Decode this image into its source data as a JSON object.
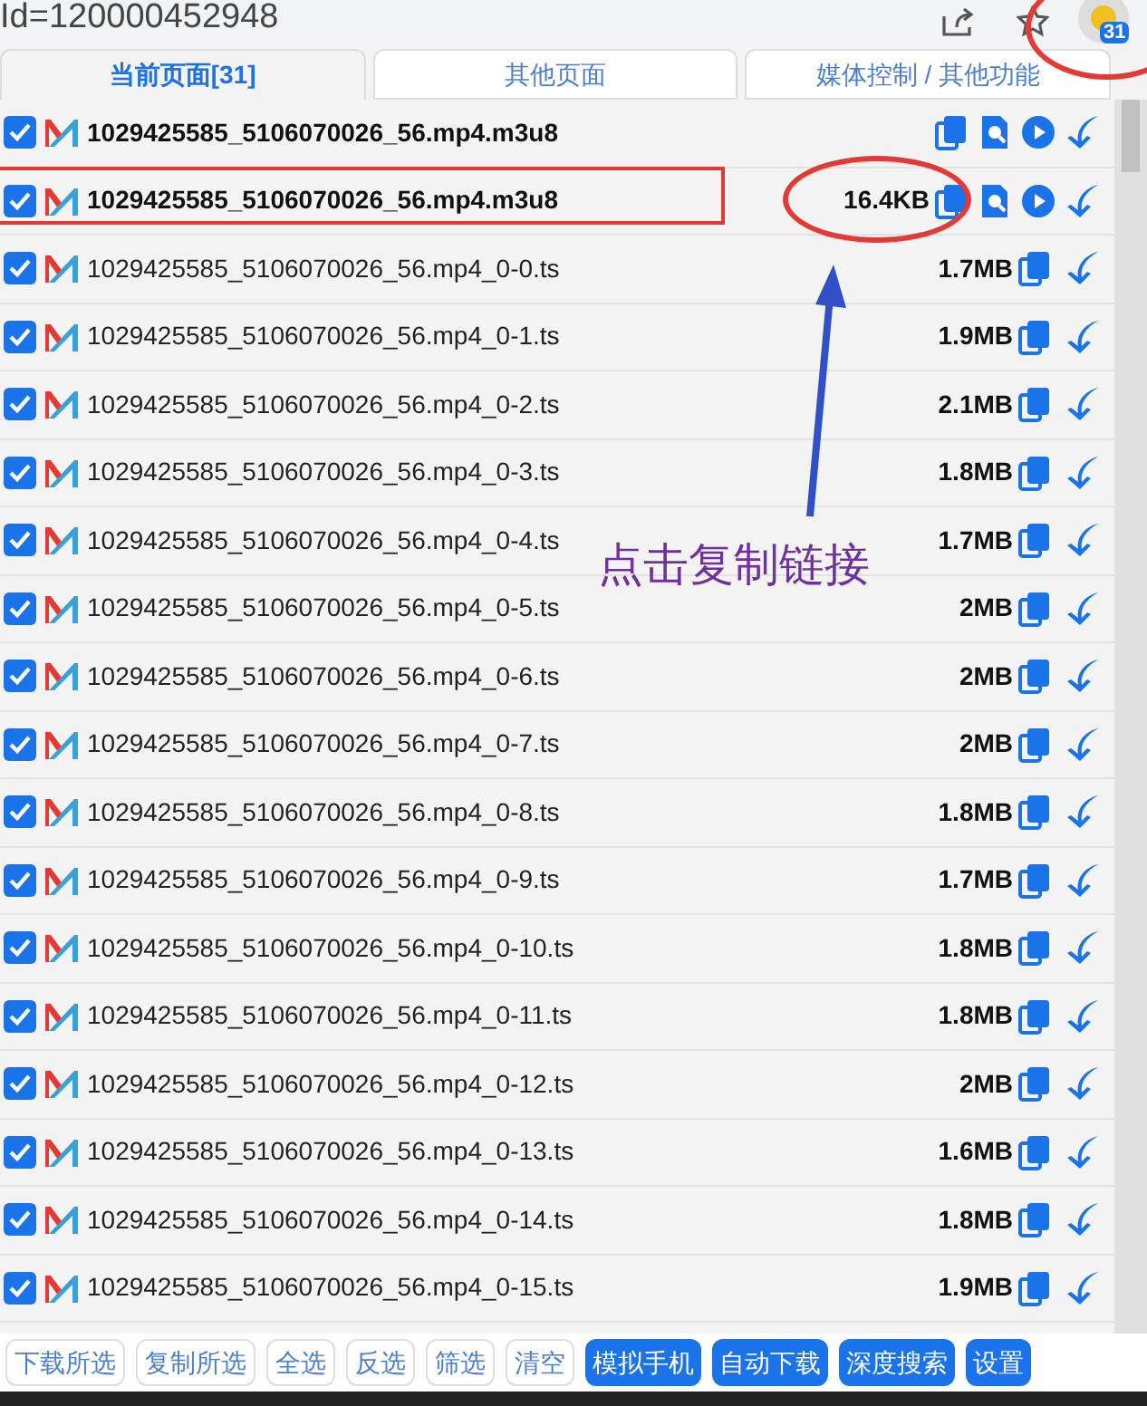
{
  "browser": {
    "address": "Id=120000452948",
    "extension_badge": "31"
  },
  "tabs": [
    {
      "label": "当前页面[31]",
      "selected": true
    },
    {
      "label": "其他页面",
      "selected": false
    },
    {
      "label": "媒体控制 / 其他功能",
      "selected": false
    }
  ],
  "rows": [
    {
      "kind": "playlist",
      "name": "1029425585_5106070026_56.mp4.m3u8",
      "checked": true
    },
    {
      "kind": "playlist",
      "name": "1029425585_5106070026_56.mp4.m3u8",
      "size": "16.4KB",
      "checked": true
    },
    {
      "kind": "segment",
      "name": "1029425585_5106070026_56.mp4_0-0.ts",
      "size": "1.7MB",
      "checked": true
    },
    {
      "kind": "segment",
      "name": "1029425585_5106070026_56.mp4_0-1.ts",
      "size": "1.9MB",
      "checked": true
    },
    {
      "kind": "segment",
      "name": "1029425585_5106070026_56.mp4_0-2.ts",
      "size": "2.1MB",
      "checked": true
    },
    {
      "kind": "segment",
      "name": "1029425585_5106070026_56.mp4_0-3.ts",
      "size": "1.8MB",
      "checked": true
    },
    {
      "kind": "segment",
      "name": "1029425585_5106070026_56.mp4_0-4.ts",
      "size": "1.7MB",
      "checked": true
    },
    {
      "kind": "segment",
      "name": "1029425585_5106070026_56.mp4_0-5.ts",
      "size": "2MB",
      "checked": true
    },
    {
      "kind": "segment",
      "name": "1029425585_5106070026_56.mp4_0-6.ts",
      "size": "2MB",
      "checked": true
    },
    {
      "kind": "segment",
      "name": "1029425585_5106070026_56.mp4_0-7.ts",
      "size": "2MB",
      "checked": true
    },
    {
      "kind": "segment",
      "name": "1029425585_5106070026_56.mp4_0-8.ts",
      "size": "1.8MB",
      "checked": true
    },
    {
      "kind": "segment",
      "name": "1029425585_5106070026_56.mp4_0-9.ts",
      "size": "1.7MB",
      "checked": true
    },
    {
      "kind": "segment",
      "name": "1029425585_5106070026_56.mp4_0-10.ts",
      "size": "1.8MB",
      "checked": true
    },
    {
      "kind": "segment",
      "name": "1029425585_5106070026_56.mp4_0-11.ts",
      "size": "1.8MB",
      "checked": true
    },
    {
      "kind": "segment",
      "name": "1029425585_5106070026_56.mp4_0-12.ts",
      "size": "2MB",
      "checked": true
    },
    {
      "kind": "segment",
      "name": "1029425585_5106070026_56.mp4_0-13.ts",
      "size": "1.6MB",
      "checked": true
    },
    {
      "kind": "segment",
      "name": "1029425585_5106070026_56.mp4_0-14.ts",
      "size": "1.8MB",
      "checked": true
    },
    {
      "kind": "segment",
      "name": "1029425585_5106070026_56.mp4_0-15.ts",
      "size": "1.9MB",
      "checked": true
    }
  ],
  "buttons": [
    {
      "label": "下载所选",
      "kind": "outline"
    },
    {
      "label": "复制所选",
      "kind": "outline"
    },
    {
      "label": "全选",
      "kind": "outline"
    },
    {
      "label": "反选",
      "kind": "outline"
    },
    {
      "label": "筛选",
      "kind": "outline"
    },
    {
      "label": "清空",
      "kind": "outline"
    },
    {
      "label": "模拟手机",
      "kind": "filled"
    },
    {
      "label": "自动下载",
      "kind": "filled"
    },
    {
      "label": "深度搜索",
      "kind": "filled"
    },
    {
      "label": "设置",
      "kind": "filled"
    }
  ],
  "annotation": {
    "note": "点击复制链接"
  }
}
